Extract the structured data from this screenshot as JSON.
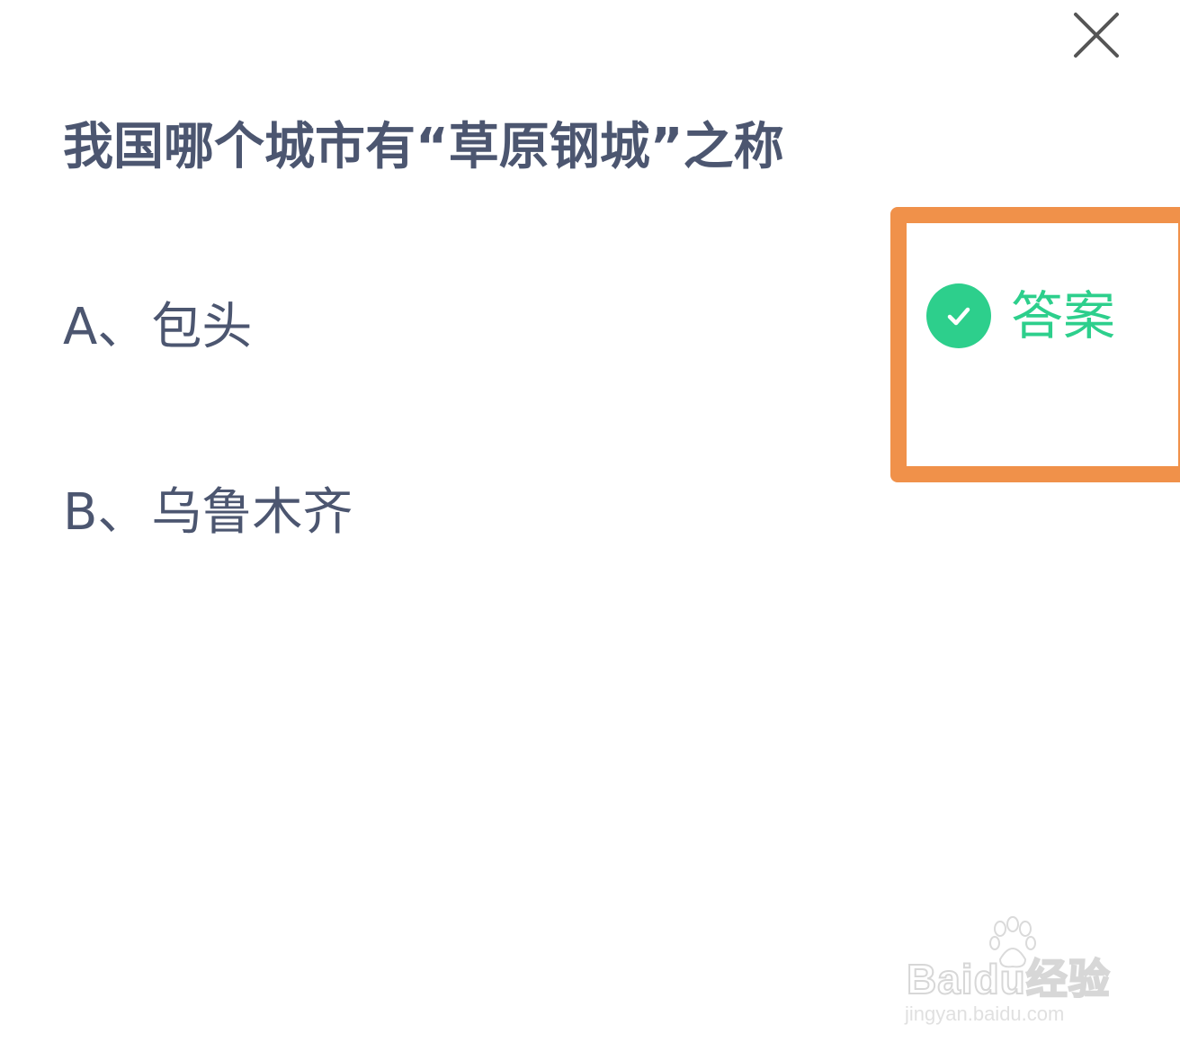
{
  "question": {
    "text": "我国哪个城市有“草原钢城”之称"
  },
  "options": [
    {
      "letter": "A、",
      "text": "包头"
    },
    {
      "letter": "B、",
      "text": "乌鲁木齐"
    }
  ],
  "answer_badge": {
    "label": "答案",
    "icon": "check-circle-icon",
    "color": "#2dcf8c"
  },
  "highlight_color": "#f0914a",
  "close_icon": "close-icon",
  "watermark": {
    "logo": "Baidu经验",
    "url": "jingyan.baidu.com"
  }
}
